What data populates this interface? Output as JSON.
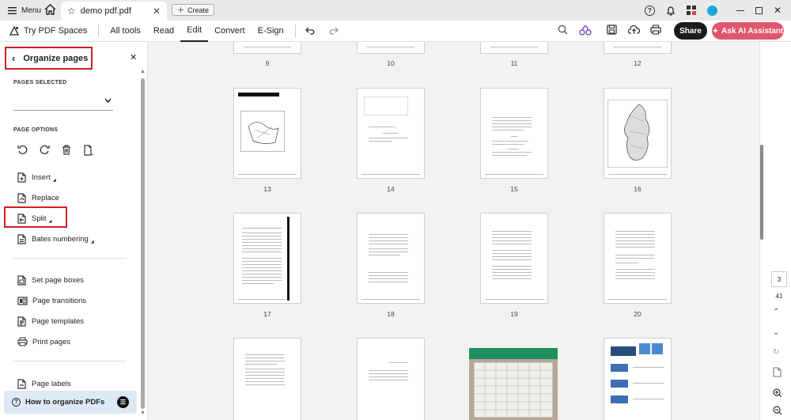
{
  "titlebar": {
    "menu_label": "Menu",
    "tab_title": "demo pdf.pdf",
    "create_label": "Create"
  },
  "toolbar": {
    "try_label": "Try PDF Spaces",
    "items": [
      "All tools",
      "Read",
      "Edit",
      "Convert",
      "E-Sign"
    ],
    "active": "Edit",
    "share_label": "Share",
    "ai_label": "Ask AI Assistant"
  },
  "panel": {
    "title": "Organize pages",
    "pages_selected_label": "PAGES SELECTED",
    "page_options_label": "PAGE OPTIONS",
    "options": {
      "insert": "Insert",
      "replace": "Replace",
      "split": "Split",
      "bates": "Bates numbering",
      "set_boxes": "Set page boxes",
      "transitions": "Page transitions",
      "templates": "Page templates",
      "print": "Print pages",
      "labels": "Page labels"
    },
    "howto_label": "How to organize PDFs"
  },
  "pages": {
    "row1": [
      "9",
      "10",
      "11",
      "12"
    ],
    "row2": [
      "13",
      "14",
      "15",
      "16"
    ],
    "row3": [
      "17",
      "18",
      "19",
      "20"
    ]
  },
  "rail": {
    "current_page": "3",
    "total_pages": "41"
  },
  "colors": {
    "accent_red": "#d01f25",
    "ai_button": "#e0566d",
    "share_button": "#1b1b1b"
  }
}
